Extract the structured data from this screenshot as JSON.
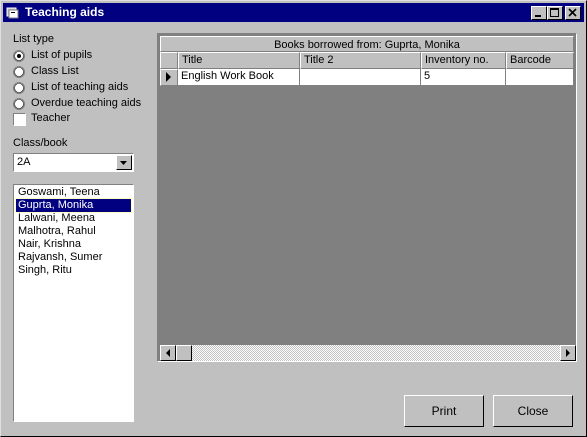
{
  "window": {
    "title": "Teaching aids"
  },
  "list_type": {
    "label": "List type",
    "options": [
      {
        "label": "List of pupils",
        "selected": true
      },
      {
        "label": "Class List",
        "selected": false
      },
      {
        "label": "List of teaching aids",
        "selected": false
      },
      {
        "label": "Overdue teaching aids",
        "selected": false
      }
    ],
    "teacher": {
      "label": "Teacher",
      "checked": false
    }
  },
  "class_book": {
    "label": "Class/book",
    "value": "2A"
  },
  "pupils": [
    {
      "name": "Goswami, Teena",
      "selected": false
    },
    {
      "name": "Guprta, Monika",
      "selected": true
    },
    {
      "name": "Lalwani, Meena",
      "selected": false
    },
    {
      "name": "Malhotra, Rahul",
      "selected": false
    },
    {
      "name": "Nair, Krishna",
      "selected": false
    },
    {
      "name": "Rajvansh, Sumer",
      "selected": false
    },
    {
      "name": "Singh, Ritu",
      "selected": false
    }
  ],
  "grid": {
    "caption": "Books borrowed from: Guprta, Monika",
    "columns": [
      "Title",
      "Title 2",
      "Inventory no.",
      "Barcode"
    ],
    "rows": [
      {
        "title": "English Work Book",
        "title2": "",
        "inventory": "5",
        "barcode": ""
      }
    ]
  },
  "buttons": {
    "print": "Print",
    "close": "Close"
  },
  "colors": {
    "title_bar": "#000080",
    "face": "#c0c0c0",
    "selection": "#000080"
  }
}
